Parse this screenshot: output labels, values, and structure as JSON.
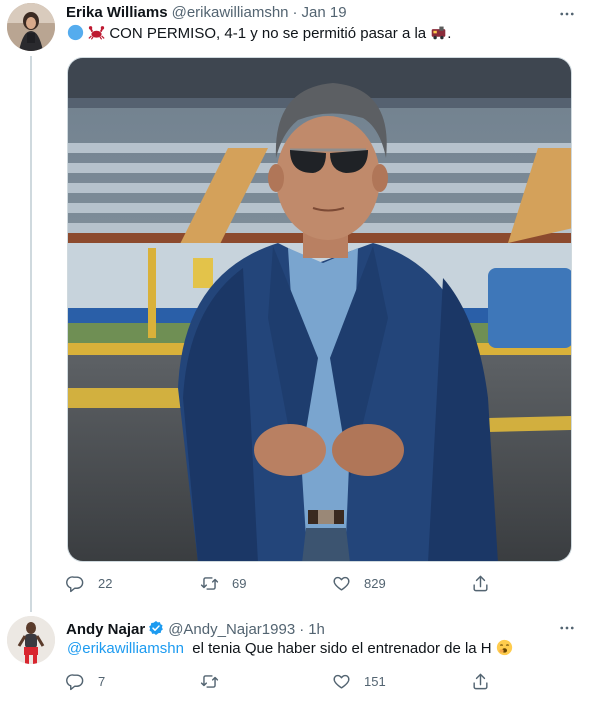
{
  "tweet1": {
    "author_name": "Erika Williams",
    "handle": "@erikawilliamshn",
    "dot": "·",
    "date": "Jan 19",
    "text": "CON PERMISO, 4-1 y no se permitió pasar a la",
    "end_punct": ".",
    "emojis_before": [
      "blue-circle-icon",
      "crab-icon"
    ],
    "emoji_after": "train-icon",
    "image_alt": "Man in sunglasses and blue blazer standing in a stadium",
    "stats": {
      "replies": "22",
      "retweets": "69",
      "likes": "829"
    }
  },
  "tweet2": {
    "author_name": "Andy Najar",
    "verified": true,
    "handle": "@Andy_Najar1993",
    "dot": "·",
    "date": "1h",
    "mention": "@erikawilliamshn",
    "text": "el tenia Que haber sido el entrenador de la H",
    "emoji_after": "yawning-face-icon",
    "stats": {
      "replies": "7",
      "retweets": "",
      "likes": "151"
    }
  },
  "colors": {
    "accent": "#1d9bf0",
    "secondary_text": "#536471",
    "thread_line": "#cfd9de"
  }
}
